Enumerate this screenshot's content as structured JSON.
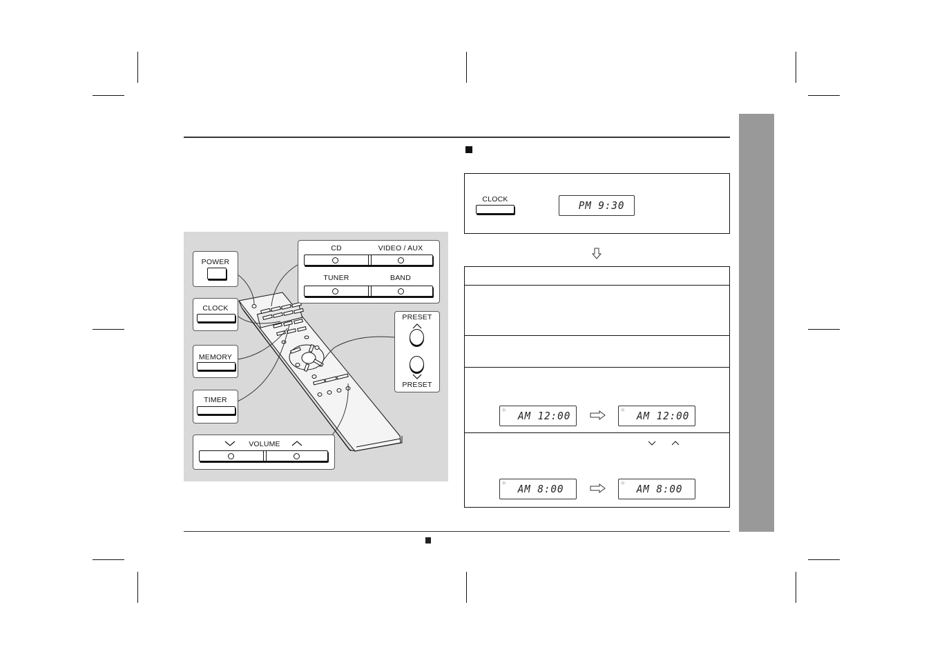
{
  "page": {
    "background": "#ffffff",
    "side_tab_color": "#999999",
    "illustration_bg": "#d9d9d9"
  },
  "remote_diagram": {
    "power_label": "POWER",
    "clock_label": "CLOCK",
    "memory_label": "MEMORY",
    "timer_label": "TIMER",
    "cd_label": "CD",
    "video_aux_label": "VIDEO / AUX",
    "tuner_label": "TUNER",
    "band_label": "BAND",
    "preset_up_label": "PRESET",
    "preset_down_label": "PRESET",
    "volume_label": "VOLUME",
    "volume_down_glyph": "∨",
    "volume_up_glyph": "∧"
  },
  "clock_step_box": {
    "button_label": "CLOCK",
    "display_text": "PM  9:30"
  },
  "steps": [
    {
      "text": ""
    },
    {
      "text": ""
    },
    {
      "text": ""
    },
    {
      "text": "",
      "display_before": "AM 12:00",
      "display_after": "AM 12:00"
    },
    {
      "text": "",
      "down_glyph": "∨",
      "up_glyph": "∧",
      "display_before": "AM  8:00",
      "display_after": "AM  8:00"
    }
  ]
}
